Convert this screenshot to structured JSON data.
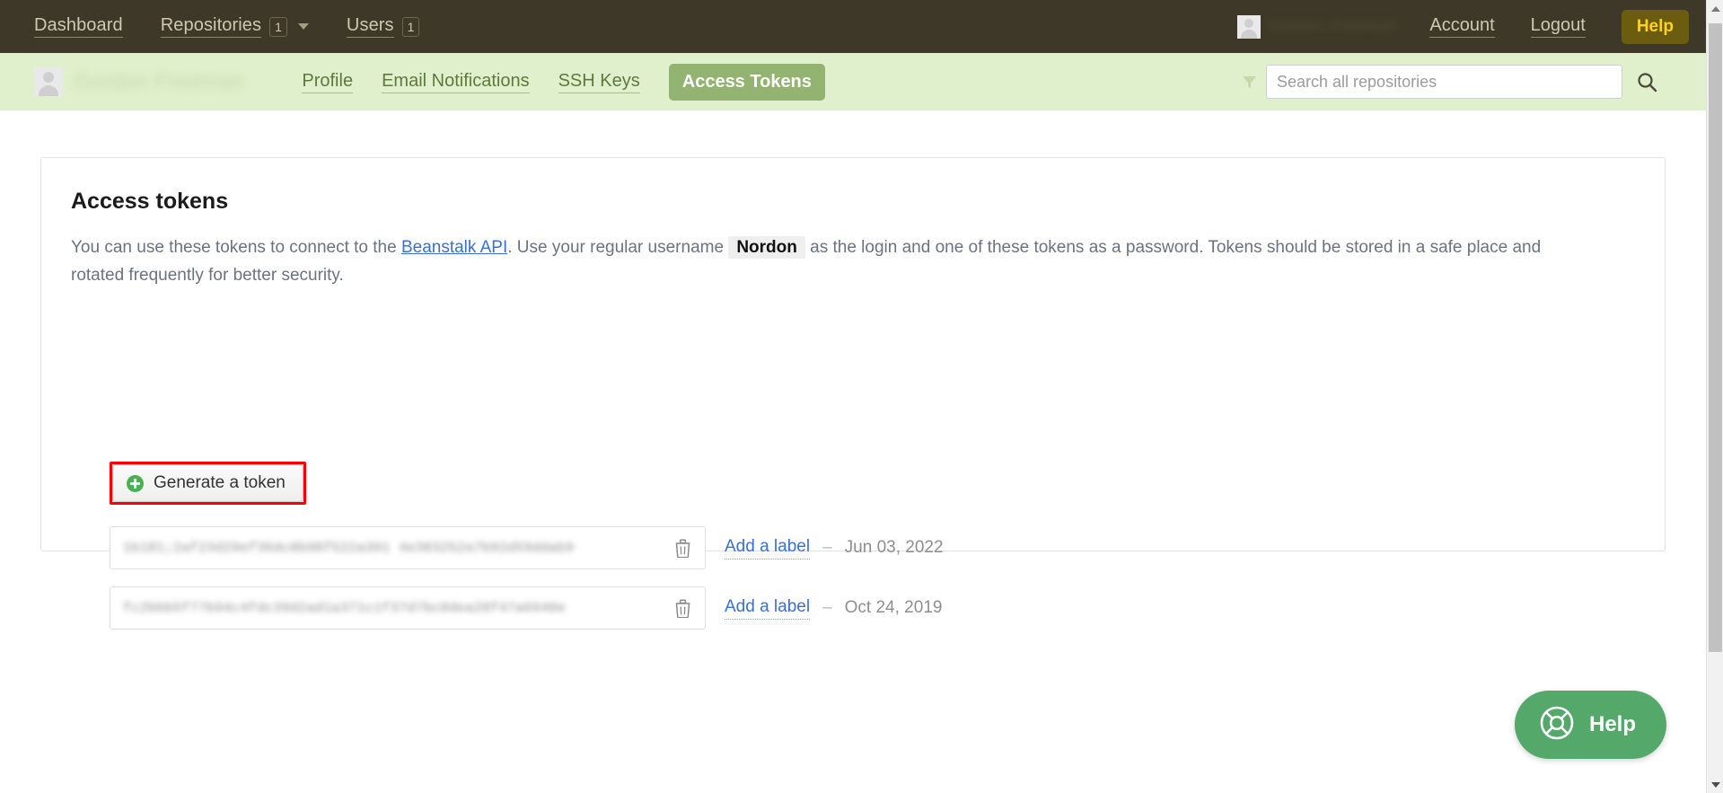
{
  "topbar": {
    "nav": [
      {
        "label": "Dashboard",
        "badge": null,
        "caret": false
      },
      {
        "label": "Repositories",
        "badge": "1",
        "caret": true
      },
      {
        "label": "Users",
        "badge": "1",
        "caret": false
      }
    ],
    "user_name_blurred": "Gordon Freeman",
    "account_label": "Account",
    "logout_label": "Logout",
    "help_label": "Help",
    "bg_color": "#3d3827",
    "help_bg_color": "#6b5c10",
    "help_text_color": "#ffd21e"
  },
  "subbar": {
    "user_name_blurred": "Gordon Freeman",
    "bg_color": "#e0f0cc",
    "active_tab_color": "#93b471",
    "tabs": [
      {
        "label": "Profile",
        "active": false
      },
      {
        "label": "Email Notifications",
        "active": false
      },
      {
        "label": "SSH Keys",
        "active": false
      },
      {
        "label": "Access Tokens",
        "active": true
      }
    ],
    "search": {
      "placeholder": "Search all repositories",
      "value": "",
      "filter_icon": "funnel-icon",
      "submit_icon": "magnifier-icon"
    }
  },
  "card": {
    "title": "Access tokens",
    "desc_part1": "You can use these tokens to connect to the ",
    "desc_link": "Beanstalk API",
    "desc_part2": ". Use your regular username ",
    "desc_username": "Nordon",
    "desc_part3": " as the login and one of these tokens as a password. Tokens should be stored in a safe place and rotated frequently for better security.",
    "generate_button": {
      "label": "Generate a token",
      "icon": "plus-circle-icon",
      "highlight_color": "#ff0000",
      "highlighted": true
    },
    "tokens": [
      {
        "value_blurred": "1b181;2af23d29ef36dc8b98f522a391 4e383252a7b92d59ddab9",
        "delete_icon": "trash-icon",
        "label_link": "Add a label",
        "separator": "–",
        "date": "Jun 03, 2022"
      },
      {
        "value_blurred": "fc2bbb5f77b94c4fdc39d2ad1a371c1f37d7bc0dea28f47a6940e",
        "delete_icon": "trash-icon",
        "label_link": "Add a label",
        "separator": "–",
        "date": "Oct 24, 2019"
      }
    ]
  },
  "help_fab": {
    "label": "Help",
    "icon": "lifebuoy-icon",
    "bg_color": "#53a86a"
  },
  "scrollbar": {
    "up_icon": "scroll-up-arrow-icon",
    "down_icon": "scroll-down-arrow-icon"
  }
}
